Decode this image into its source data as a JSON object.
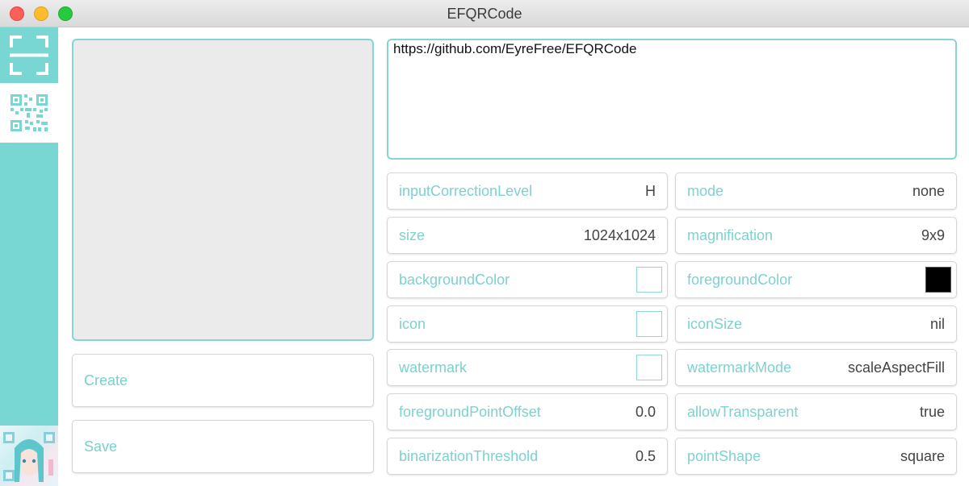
{
  "window": {
    "title": "EFQRCode"
  },
  "sidebar": {
    "items": [
      {
        "icon": "scan-icon",
        "selected": false
      },
      {
        "icon": "qrcode-icon",
        "selected": true
      }
    ],
    "thumbnail_icon": "anime-qrcode-thumbnail"
  },
  "actions": {
    "create_label": "Create",
    "save_label": "Save"
  },
  "input": {
    "text": "https://github.com/EyreFree/EFQRCode"
  },
  "params": {
    "left": [
      {
        "label": "inputCorrectionLevel",
        "value": "H"
      },
      {
        "label": "size",
        "value": "1024x1024"
      },
      {
        "label": "backgroundColor",
        "value": ""
      },
      {
        "label": "icon",
        "value": ""
      },
      {
        "label": "watermark",
        "value": ""
      },
      {
        "label": "foregroundPointOffset",
        "value": "0.0"
      },
      {
        "label": "binarizationThreshold",
        "value": "0.5"
      }
    ],
    "right": [
      {
        "label": "mode",
        "value": "none"
      },
      {
        "label": "magnification",
        "value": "9x9"
      },
      {
        "label": "foregroundColor",
        "value": ""
      },
      {
        "label": "iconSize",
        "value": "nil"
      },
      {
        "label": "watermarkMode",
        "value": "scaleAspectFill"
      },
      {
        "label": "allowTransparent",
        "value": "true"
      },
      {
        "label": "pointShape",
        "value": "square"
      }
    ]
  },
  "colors": {
    "accent": "#78d6d3",
    "background_swatch": "#ffffff",
    "foreground_swatch": "#000000"
  }
}
